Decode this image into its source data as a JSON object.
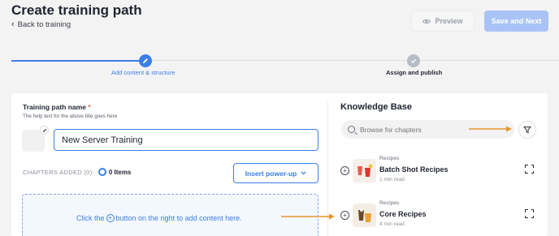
{
  "header": {
    "title": "Create training path",
    "back_label": "Back to training",
    "preview_label": "Preview",
    "save_label": "Save and Next"
  },
  "stepper": {
    "steps": [
      {
        "label": "Add content & structure",
        "state": "active"
      },
      {
        "label": "Assign and publish",
        "state": "inactive"
      }
    ]
  },
  "form": {
    "name_label": "Training path name",
    "required_mark": "*",
    "help_text": "The help text for the above title goes here",
    "name_value": "New Server Training",
    "chapters_label": "CHAPTERS ADDED (0):",
    "items_count": "0 Items",
    "insert_label": "Insert power-up",
    "drop_text_before": "Click the",
    "drop_text_after": "button on the right to add content here."
  },
  "knowledge_base": {
    "title": "Knowledge Base",
    "search_placeholder": "Browse for chapters",
    "items": [
      {
        "category": "Recipes",
        "name": "Batch Shot Recipes",
        "read_time": "1 min read",
        "thumb_color": "#e8483b"
      },
      {
        "category": "Recipes",
        "name": "Core Recipes",
        "read_time": "4 min read",
        "thumb_color": "#e9a23a"
      }
    ]
  },
  "colors": {
    "primary": "#3b7ee8",
    "annotation_arrow": "#e8962e",
    "save_disabled": "#a9c3f6"
  }
}
